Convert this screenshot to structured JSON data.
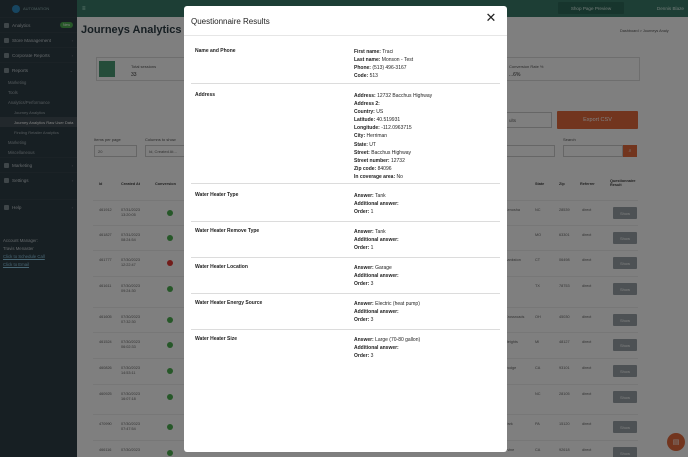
{
  "app": {
    "logo_text": "AUTOMATION",
    "sidebar": [
      {
        "label": "Analytics",
        "badge": "New"
      },
      {
        "label": "Store Management"
      },
      {
        "label": "Corporate Reports"
      },
      {
        "label": "Reports"
      }
    ],
    "reports_children": [
      "Marketing",
      "Tools",
      "Analytics/Performance"
    ],
    "analytics_children": [
      "Journey Analytics",
      "Journey Analytics Raw User Data",
      "Finding Retailer Analytics"
    ],
    "more_children": [
      "Marketing",
      "Miscellaneous"
    ],
    "sidebar_bottom": [
      {
        "label": "Marketing"
      },
      {
        "label": "Settings"
      }
    ],
    "help_label": "Help",
    "manager": {
      "title": "Account Manager:",
      "name": "Travis Menaster",
      "schedule": "Click to Schedule Call",
      "email": "Click to Email"
    },
    "preview_button": "Shop Page Preview",
    "user_name": "Dennis Blaze",
    "page_title": "Journeys Analytics",
    "breadcrumb": "Dashboard > Journeys Analy",
    "stat_label": "Total sessions",
    "stat_value": "33",
    "conv_label": "Conversion Rate %",
    "conv_value": "...6%",
    "period_placeholder": "ults",
    "export_label": "Export CSV",
    "items_label": "Items per page",
    "items_value": "20",
    "columns_label": "Columns to show",
    "columns_value": "Id, Created At...",
    "search_label": "Search",
    "table_headers": [
      "Id",
      "Created At",
      "Conversion",
      "State",
      "Zip",
      "Referrer",
      "Questionnaire Result"
    ],
    "rows": [
      {
        "id": "461912",
        "date": "07/31/2023",
        "time": "13:20:05",
        "ok": true,
        "city": "Kenosha",
        "state": "NC",
        "zip": "28539",
        "ref": "direct"
      },
      {
        "id": "461827",
        "date": "07/31/2023",
        "time": "08:24:54",
        "ok": true,
        "city": "",
        "state": "MO",
        "zip": "63301",
        "ref": "direct"
      },
      {
        "id": "461777",
        "date": "07/30/2023",
        "time": "12:22:47",
        "ok": false,
        "city": "Bankston",
        "state": "CT",
        "zip": "06498",
        "ref": "direct"
      },
      {
        "id": "461611",
        "date": "07/30/2023",
        "time": "09:24:30",
        "ok": true,
        "city": "",
        "state": "TX",
        "zip": "78753",
        "ref": "direct"
      },
      {
        "id": "461605",
        "date": "07/30/2023",
        "time": "07:32:30",
        "ok": true,
        "city": "Crossroads",
        "state": "OH",
        "zip": "45030",
        "ref": "direct"
      },
      {
        "id": "461524",
        "date": "07/30/2023",
        "time": "06:02:33",
        "ok": true,
        "city": "Heights",
        "state": "MI",
        "zip": "48127",
        "ref": "direct"
      },
      {
        "id": "460826",
        "date": "07/30/2023",
        "time": "14:53:11",
        "ok": true,
        "city": "Dodge",
        "state": "CA",
        "zip": "93101",
        "ref": "direct"
      },
      {
        "id": "460925",
        "date": "07/30/2023",
        "time": "16:07:18",
        "ok": true,
        "city": "",
        "state": "NC",
        "zip": "28105",
        "ref": "direct"
      },
      {
        "id": "470990",
        "date": "07/30/2023",
        "time": "07:47:54",
        "ok": true,
        "city": "Park",
        "state": "PA",
        "zip": "15120",
        "ref": "direct"
      },
      {
        "id": "466116",
        "date": "07/30/2023",
        "time": "",
        "ok": true,
        "city": "Irvine",
        "state": "CA",
        "zip": "92618",
        "ref": "direct"
      }
    ],
    "show_label": "Show"
  },
  "modal": {
    "title": "Questionnaire Results",
    "sections": [
      {
        "label": "Name and Phone",
        "items": [
          {
            "k": "First name:",
            "v": "Traci"
          },
          {
            "k": "Last name:",
            "v": "Monson - Test"
          },
          {
            "k": "Phone:",
            "v": "(513) 496-3167"
          },
          {
            "k": "Code:",
            "v": "513"
          }
        ]
      },
      {
        "label": "Address",
        "items": [
          {
            "k": "Address:",
            "v": "12732 Bacchus Highway"
          },
          {
            "k": "Address 2:",
            "v": ""
          },
          {
            "k": "Country:",
            "v": "US"
          },
          {
            "k": "Latitude:",
            "v": "40.519931"
          },
          {
            "k": "Longitude:",
            "v": "-112.0963715"
          },
          {
            "k": "City:",
            "v": "Herriman"
          },
          {
            "k": "State:",
            "v": "UT"
          },
          {
            "k": "Street:",
            "v": "Bacchus Highway"
          },
          {
            "k": "Street number:",
            "v": "12732"
          },
          {
            "k": "Zip code:",
            "v": "84096"
          },
          {
            "k": "In coverage area:",
            "v": "No"
          }
        ]
      },
      {
        "label": "Water Heater Type",
        "items": [
          {
            "k": "Answer:",
            "v": "Tank"
          },
          {
            "k": "Additional answer:",
            "v": ""
          },
          {
            "k": "Order:",
            "v": "1"
          }
        ]
      },
      {
        "label": "Water Heater Remove Type",
        "items": [
          {
            "k": "Answer:",
            "v": "Tank"
          },
          {
            "k": "Additional answer:",
            "v": ""
          },
          {
            "k": "Order:",
            "v": "1"
          }
        ]
      },
      {
        "label": "Water Heater Location",
        "items": [
          {
            "k": "Answer:",
            "v": "Garage"
          },
          {
            "k": "Additional answer:",
            "v": ""
          },
          {
            "k": "Order:",
            "v": "3"
          }
        ]
      },
      {
        "label": "Water Heater Energy Source",
        "items": [
          {
            "k": "Answer:",
            "v": "Electric (heat pump)"
          },
          {
            "k": "Additional answer:",
            "v": ""
          },
          {
            "k": "Order:",
            "v": "3"
          }
        ]
      },
      {
        "label": "Water Heater Size",
        "items": [
          {
            "k": "Answer:",
            "v": "Large (70-80 gallon)"
          },
          {
            "k": "Additional answer:",
            "v": ""
          },
          {
            "k": "Order:",
            "v": "3"
          }
        ]
      }
    ]
  }
}
